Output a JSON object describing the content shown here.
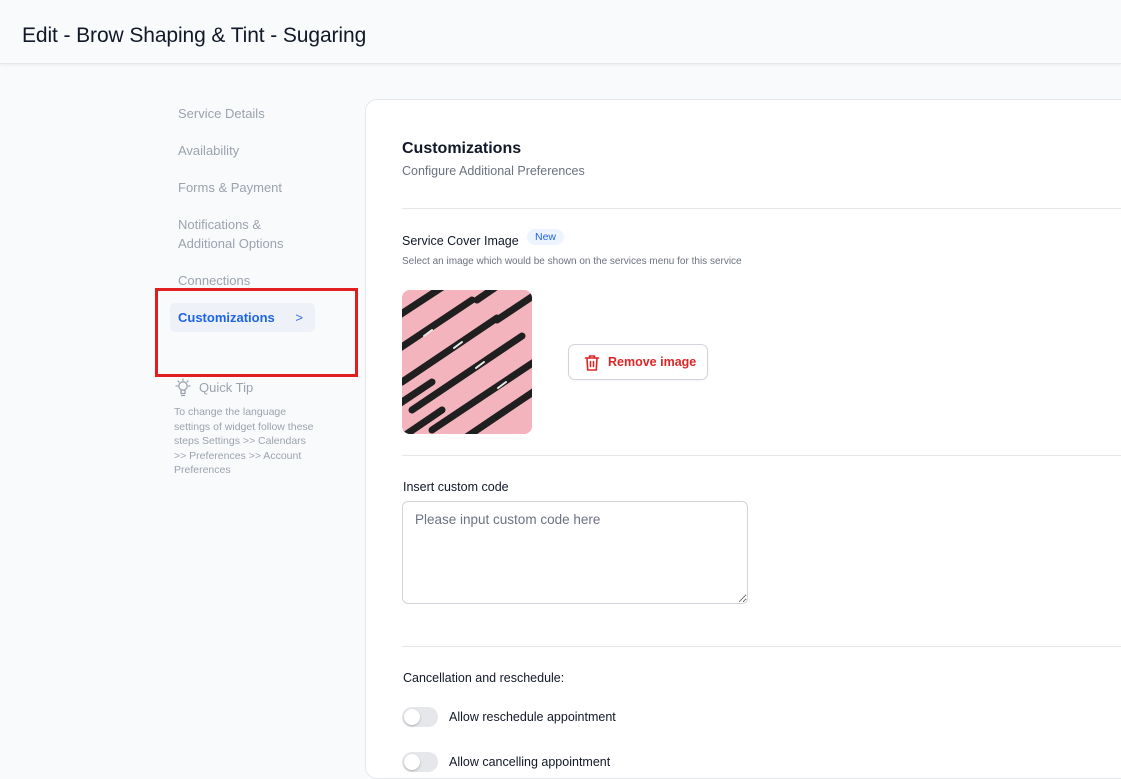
{
  "header": {
    "title": "Edit - Brow Shaping & Tint - Sugaring"
  },
  "sidebar": {
    "items": [
      {
        "label": "Service Details"
      },
      {
        "label": "Availability"
      },
      {
        "label": "Forms & Payment"
      },
      {
        "label": "Notifications & Additional Options"
      },
      {
        "label": "Connections"
      },
      {
        "label": "Customizations",
        "active": true,
        "chevron": ">"
      }
    ],
    "quick_tip": {
      "title": "Quick Tip",
      "body": "To change the language settings of widget follow these steps Settings >> Calendars >> Preferences >> Account Preferences"
    }
  },
  "main": {
    "title": "Customizations",
    "subtitle": "Configure Additional Preferences",
    "cover_image": {
      "label": "Service Cover Image",
      "badge": "New",
      "hint": "Select an image which would be shown on the services menu for this service",
      "remove_label": "Remove image"
    },
    "custom_code": {
      "label": "Insert custom code",
      "placeholder": "Please input custom code here",
      "value": ""
    },
    "cancellation": {
      "label": "Cancellation and reschedule:",
      "toggles": [
        {
          "label": "Allow reschedule appointment",
          "on": false
        },
        {
          "label": "Allow cancelling appointment",
          "on": false
        }
      ]
    }
  },
  "colors": {
    "accent": "#1d64e8",
    "danger": "#dc2626",
    "highlight": "#e11d1d",
    "image_bg": "#f3b4bd"
  },
  "icons": [
    "lightbulb-icon",
    "trash-icon",
    "chevron-right-icon"
  ]
}
